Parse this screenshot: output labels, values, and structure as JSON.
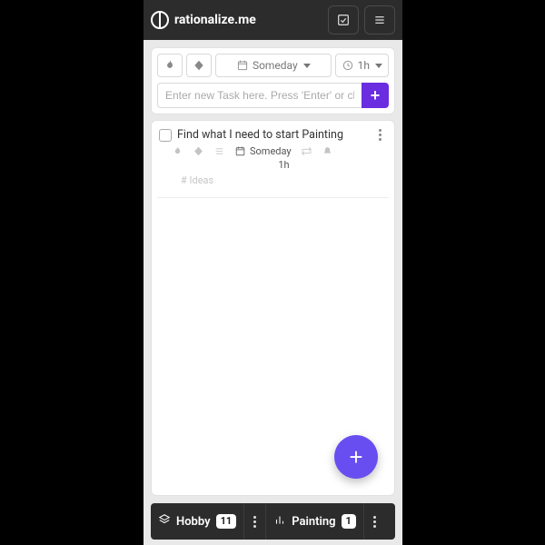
{
  "brand": "rationalize.me",
  "filters": {
    "someday_label": "Someday",
    "duration_label": "1h"
  },
  "input": {
    "placeholder": "Enter new Task here. Press 'Enter' or click or",
    "add_label": "+"
  },
  "task": {
    "title": "Find what I need to start Painting",
    "date_label": "Someday",
    "duration_label": "1h",
    "tags_placeholder": "# Ideas"
  },
  "fab": {
    "label": "+"
  },
  "tabs": [
    {
      "icon": "layers",
      "label": "Hobby",
      "count": "11"
    },
    {
      "icon": "bars",
      "label": "Painting",
      "count": "1"
    }
  ]
}
